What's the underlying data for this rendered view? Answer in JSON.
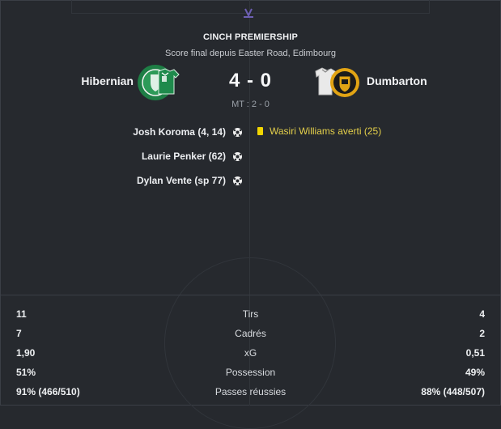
{
  "match": {
    "competition": "CINCH PREMIERSHIP",
    "subtitle": "Score final depuis Easter Road, Edimbourg",
    "home_team": "Hibernian",
    "away_team": "Dumbarton",
    "score": "4 - 0",
    "half_time": "MT : 2 - 0"
  },
  "events": {
    "home_goals": [
      "Josh Koroma (4, 14)",
      "Laurie Penker (62)",
      "Dylan Vente (sp 77)"
    ],
    "away_booking": "Wasiri Williams averti (25)"
  },
  "stats": [
    {
      "home": "11",
      "label": "Tirs",
      "away": "4"
    },
    {
      "home": "7",
      "label": "Cadrés",
      "away": "2"
    },
    {
      "home": "1,90",
      "label": "xG",
      "away": "0,51"
    },
    {
      "home": "51%",
      "label": "Possession",
      "away": "49%"
    },
    {
      "home": "91% (466/510)",
      "label": "Passes réussies",
      "away": "88% (448/507)"
    }
  ],
  "icons": {
    "goal": "football-icon",
    "booking": "yellow-card-icon",
    "home_crest": "hibernian-crest",
    "away_crest": "dumbarton-crest"
  },
  "colors": {
    "background": "#26292e",
    "yellow_card": "#f1d500",
    "booking_text": "#e4cf4a",
    "hibernian_green": "#1f8a4c",
    "dumbarton_gold": "#e2a414"
  }
}
